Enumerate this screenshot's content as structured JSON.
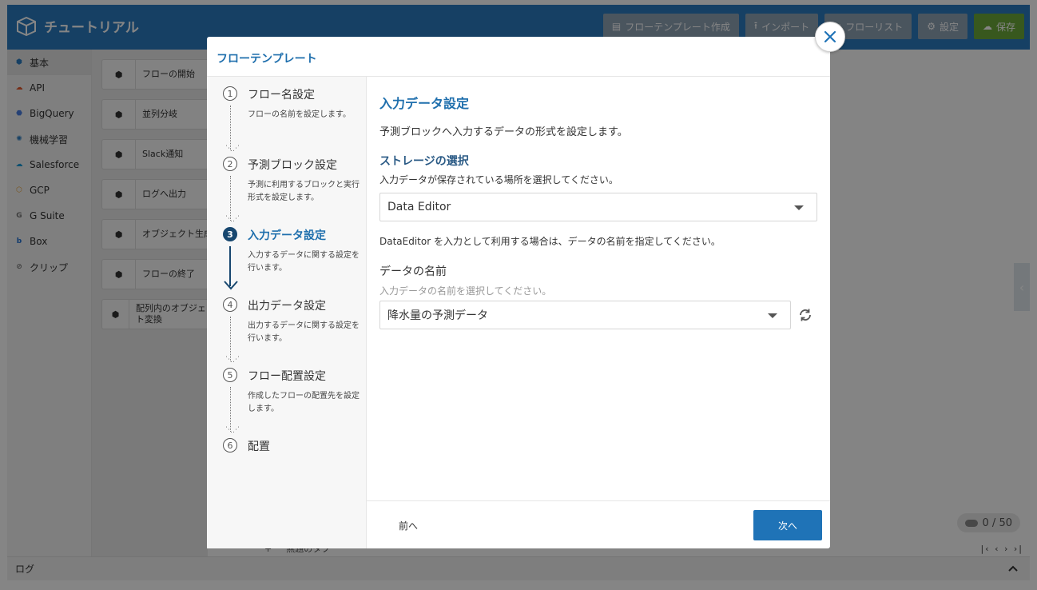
{
  "app": {
    "title": "チュートリアル",
    "toolbar": {
      "template_create": "フローテンプレート作成",
      "import": "インポート",
      "flow_list": "フローリスト",
      "settings": "設定",
      "save": "保存"
    },
    "colors": {
      "header": "#2b7cc0",
      "save": "#6ba93a",
      "accent": "#1f6fad"
    }
  },
  "sidebar": {
    "items": [
      {
        "label": "基本",
        "icon": "brain-cube-icon"
      },
      {
        "label": "API",
        "icon": "cloud-api-icon"
      },
      {
        "label": "BigQuery",
        "icon": "bigquery-icon"
      },
      {
        "label": "機械学習",
        "icon": "brain-icon"
      },
      {
        "label": "Salesforce",
        "icon": "salesforce-cloud-icon"
      },
      {
        "label": "GCP",
        "icon": "gcp-icon"
      },
      {
        "label": "G Suite",
        "icon": "gsuite-icon"
      },
      {
        "label": "Box",
        "icon": "box-icon"
      },
      {
        "label": "クリップ",
        "icon": "paperclip-icon"
      }
    ]
  },
  "palette": {
    "blocks": [
      {
        "label": "フローの開始"
      },
      {
        "label": "並列分岐"
      },
      {
        "label": "Slack通知"
      },
      {
        "label": "ログへ出力"
      },
      {
        "label": "オブジェクト生成"
      },
      {
        "label": "フローの終了"
      },
      {
        "label": "配列内のオブジェクト変換"
      }
    ]
  },
  "canvas": {
    "counter": "0 / 50",
    "bottom_tabs": [
      "+",
      "無題のタブ"
    ]
  },
  "log": {
    "label": "ログ"
  },
  "modal": {
    "title": "フローテンプレート",
    "steps": [
      {
        "num": "1",
        "title": "フロー名設定",
        "desc": "フローの名前を設定します。"
      },
      {
        "num": "2",
        "title": "予測ブロック設定",
        "desc": "予測に利用するブロックと実行形式を設定します。"
      },
      {
        "num": "3",
        "title": "入力データ設定",
        "desc": "入力するデータに関する設定を行います。"
      },
      {
        "num": "4",
        "title": "出力データ設定",
        "desc": "出力するデータに関する設定を行います。"
      },
      {
        "num": "5",
        "title": "フロー配置設定",
        "desc": "作成したフローの配置先を設定します。"
      },
      {
        "num": "6",
        "title": "配置",
        "desc": ""
      }
    ],
    "active_step": 3,
    "content": {
      "title": "入力データ設定",
      "description": "予測ブロックへ入力するデータの形式を設定します。",
      "storage_heading": "ストレージの選択",
      "storage_help": "入力データが保存されている場所を選択してください。",
      "storage_value": "Data Editor",
      "dataeditor_note": "DataEditor を入力として利用する場合は、データの名前を指定してください。",
      "data_name_label": "データの名前",
      "data_name_help": "入力データの名前を選択してください。",
      "data_name_value": "降水量の予測データ"
    },
    "footer": {
      "prev": "前へ",
      "next": "次へ"
    }
  }
}
